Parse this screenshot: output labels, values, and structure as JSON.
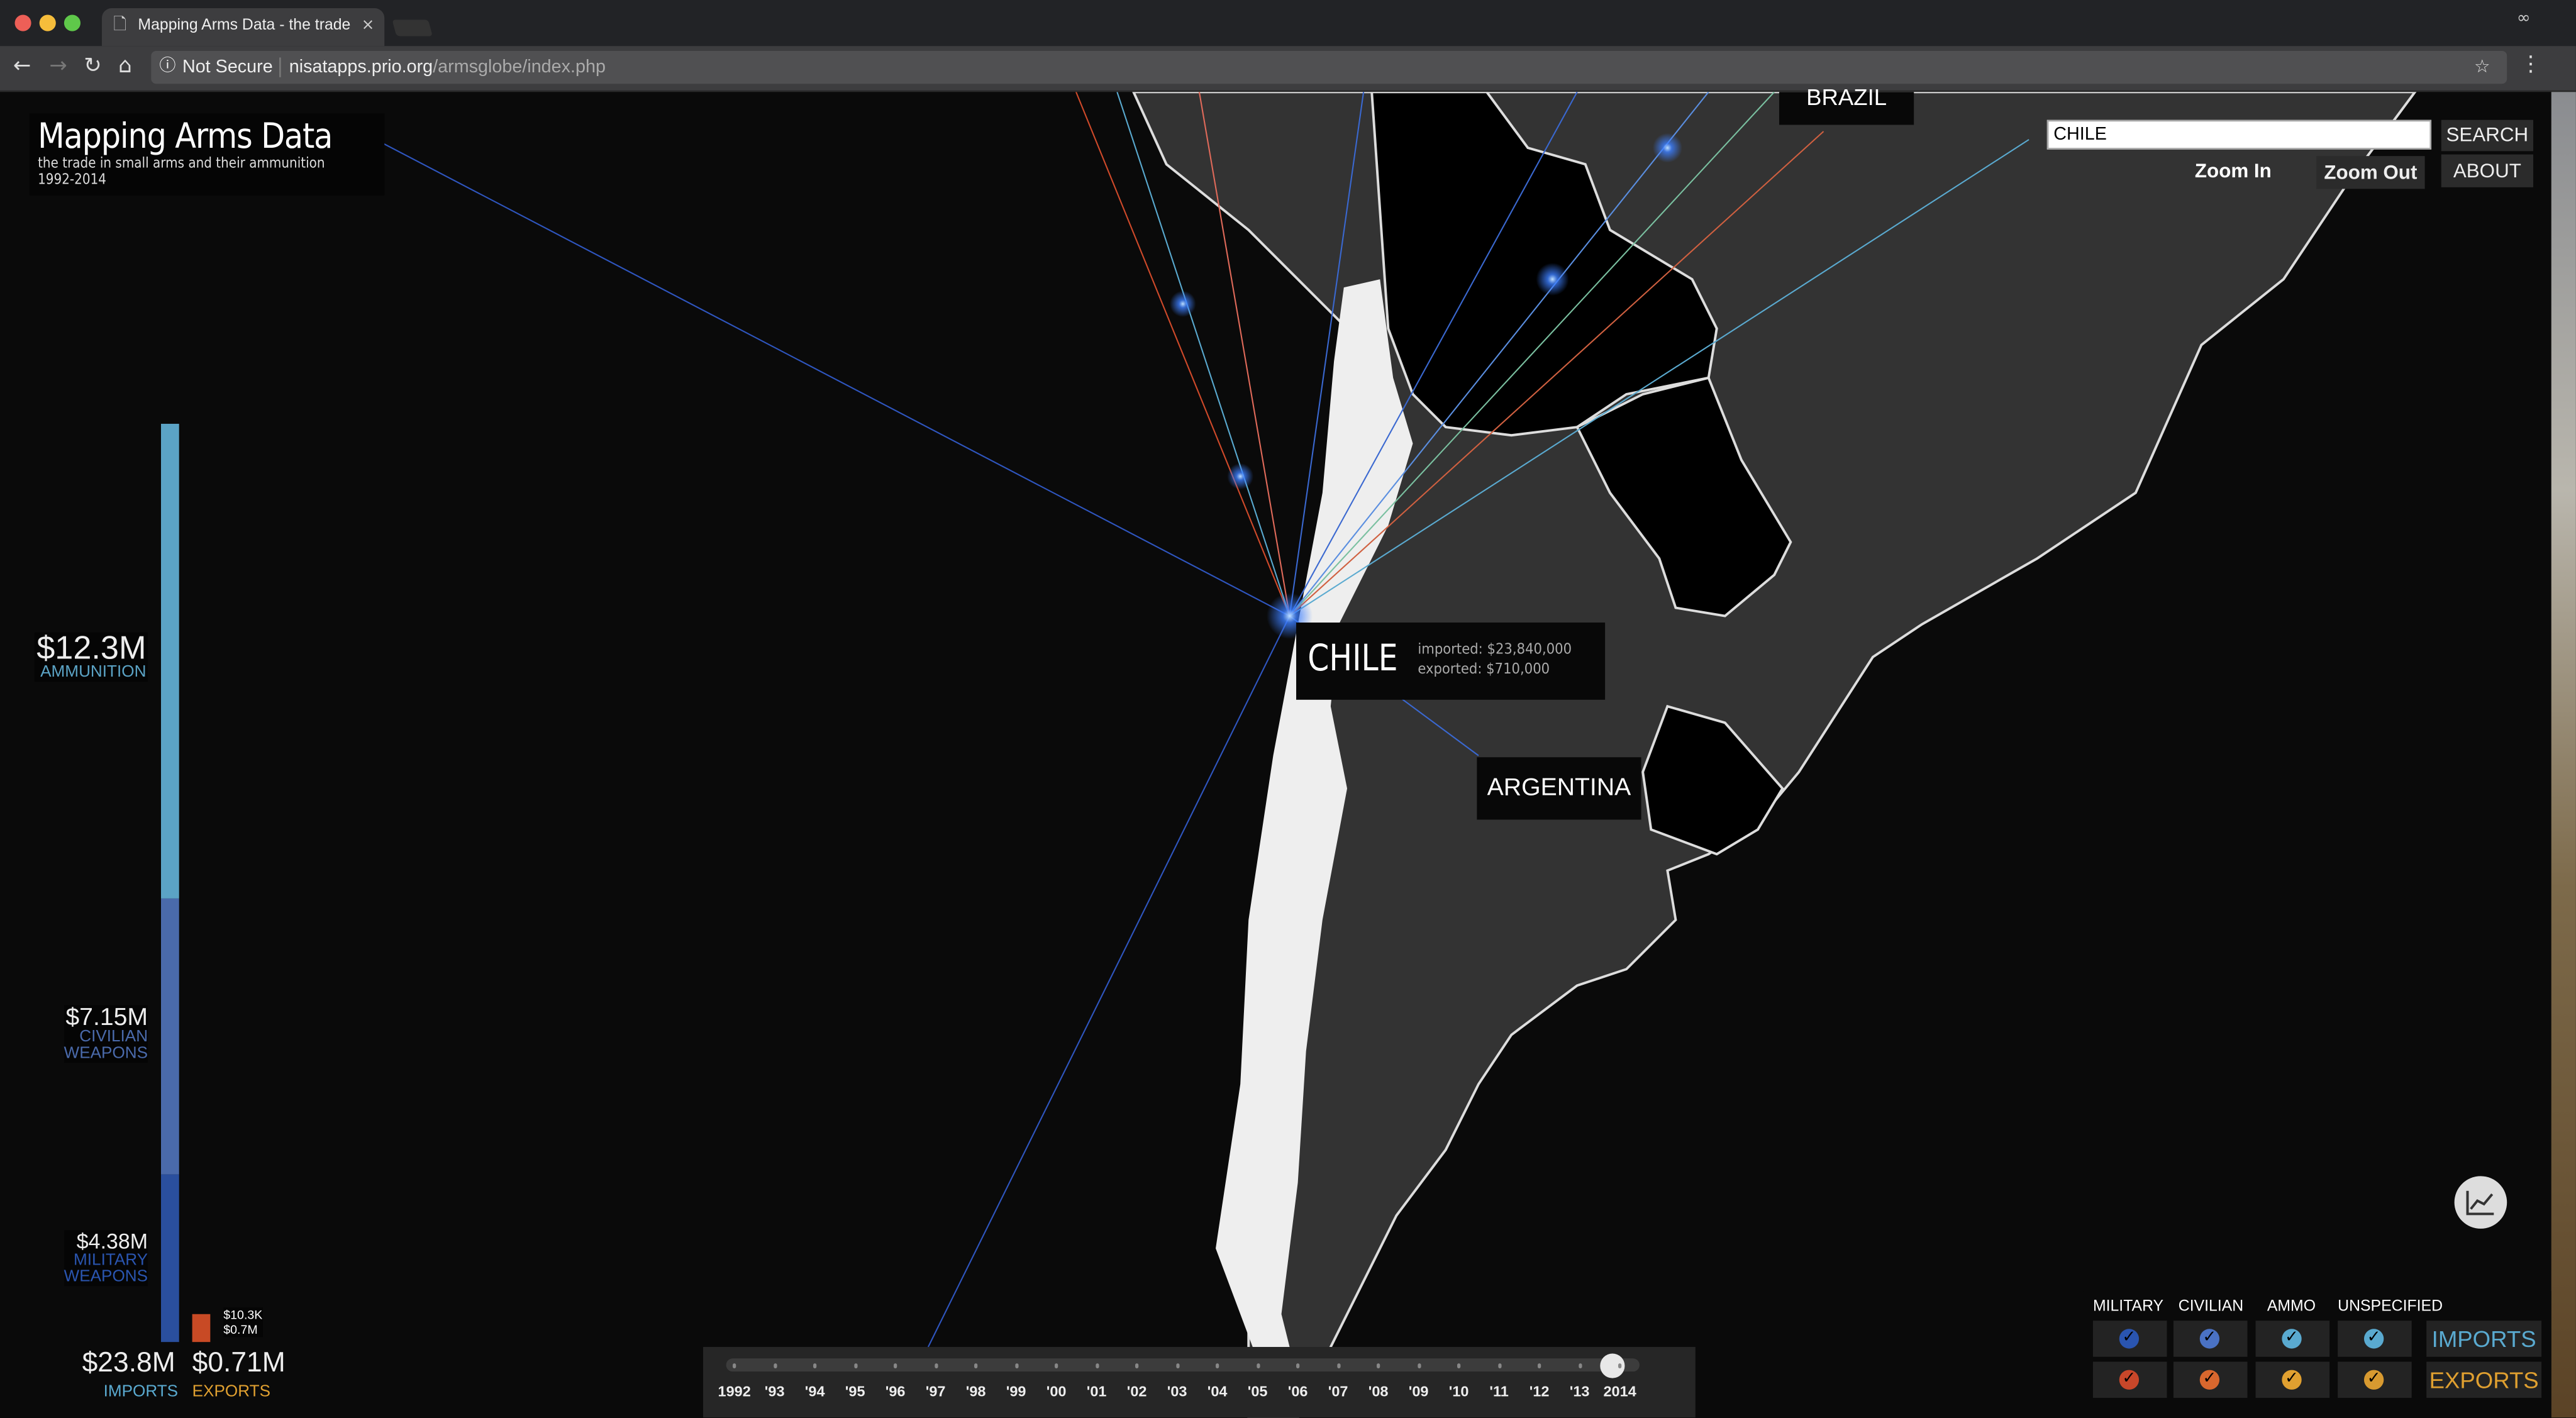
{
  "browser": {
    "tab_title": "Mapping Arms Data - the trade in small arms",
    "security_label": "Not Secure",
    "url_host": "nisatapps.prio.org",
    "url_path": "/armsglobe/index.php"
  },
  "header": {
    "title": "Mapping Arms Data",
    "subtitle": "the trade in small arms and their ammunition",
    "years": "1992-2014"
  },
  "controls": {
    "search_value": "CHILE",
    "search_label": "SEARCH",
    "zoom_in": "Zoom In",
    "zoom_out": "Zoom Out",
    "about": "ABOUT"
  },
  "map": {
    "selected_country": "CHILE",
    "imported": "imported: $23,840,000",
    "exported": "exported: $710,000",
    "labels": [
      "BRAZIL",
      "ARGENTINA"
    ]
  },
  "summary": {
    "ammunition": {
      "value": "$12.3M",
      "label": "AMMUNITION",
      "amount_m": 12.3,
      "color": "#5ba3c5"
    },
    "civilian": {
      "value": "$7.15M",
      "label1": "CIVILIAN",
      "label2": "WEAPONS",
      "amount_m": 7.15,
      "color": "#4a6aab"
    },
    "military": {
      "value": "$4.38M",
      "label1": "MILITARY",
      "label2": "WEAPONS",
      "amount_m": 4.38,
      "color": "#2a4f9e"
    },
    "export_small1": "$10.3K",
    "export_small2": "$0.7M",
    "imports_total": "$23.8M",
    "imports_label": "IMPORTS",
    "exports_total": "$0.71M",
    "exports_label": "EXPORTS",
    "export_color": "#c84a25"
  },
  "timeline": {
    "years": [
      "1992",
      "'93",
      "'94",
      "'95",
      "'96",
      "'97",
      "'98",
      "'99",
      "'00",
      "'01",
      "'02",
      "'03",
      "'04",
      "'05",
      "'06",
      "'07",
      "'08",
      "'09",
      "'10",
      "'11",
      "'12",
      "'13",
      "2014"
    ],
    "selected": "2014"
  },
  "filters": {
    "columns": [
      "MILITARY",
      "CIVILIAN",
      "AMMO",
      "UNSPECIFIED"
    ],
    "imports_label": "IMPORTS",
    "exports_label": "EXPORTS",
    "import_colors": [
      "#2a55b0",
      "#4a72c4",
      "#5aaad0",
      "#5aaad0"
    ],
    "export_colors": [
      "#c8472a",
      "#d8672e",
      "#e0a030",
      "#d89a30"
    ],
    "imports_text_color": "#5aaad0",
    "exports_text_color": "#e0a030"
  }
}
